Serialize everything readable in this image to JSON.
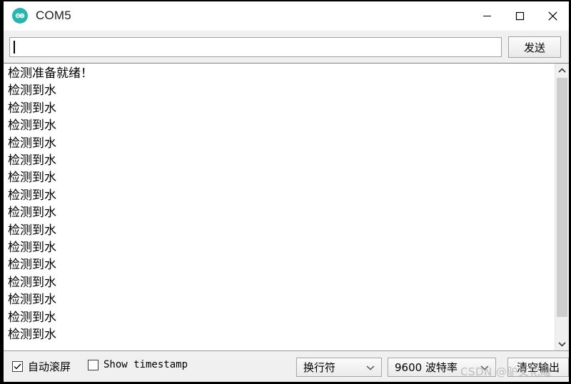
{
  "window": {
    "title": "COM5",
    "app_icon": "arduino-logo-icon",
    "accent_color": "#2bb3ad",
    "controls": {
      "minimize": "minimize-icon",
      "maximize": "maximize-icon",
      "close": "close-icon"
    }
  },
  "send_bar": {
    "input_value": "",
    "input_placeholder": "",
    "send_label": "发送"
  },
  "output": {
    "lines": [
      "检测准备就绪！",
      "检测到水",
      "检测到水",
      "检测到水",
      "检测到水",
      "检测到水",
      "检测到水",
      "检测到水",
      "检测到水",
      "检测到水",
      "检测到水",
      "检测到水",
      "检测到水",
      "检测到水",
      "检测到水",
      "检测到水"
    ],
    "scrollbar": {
      "up_icon": "chevron-up-icon",
      "down_icon": "chevron-down-icon"
    }
  },
  "status_bar": {
    "autoscroll": {
      "label": "自动滚屏",
      "checked": true
    },
    "timestamp": {
      "label": "Show timestamp",
      "checked": false
    },
    "line_ending": {
      "value": "换行符",
      "icon": "chevron-down-icon"
    },
    "baud_rate": {
      "value": "9600 波特率",
      "icon": "chevron-down-icon"
    },
    "clear_label": "清空输出"
  },
  "watermark": {
    "text": "CSDN @驴文化雕"
  }
}
